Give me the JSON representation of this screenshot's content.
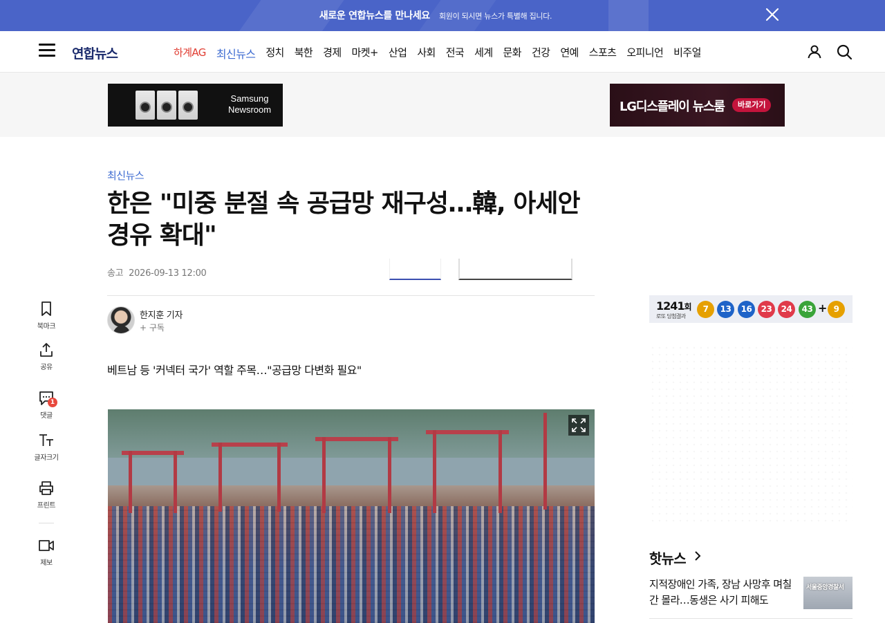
{
  "promo": {
    "main": "새로운 연합뉴스를 만나세요",
    "sub": "회원이 되시면 뉴스가 특별해 집니다.",
    "close_icon": "close-icon",
    "bg_color": "#4a64c8"
  },
  "header": {
    "logo": "연합뉴스",
    "menu_icon": "hamburger-menu-icon",
    "nav": [
      {
        "label": "하계AG",
        "state": "highlight"
      },
      {
        "label": "최신뉴스",
        "state": "active"
      },
      {
        "label": "정치"
      },
      {
        "label": "북한"
      },
      {
        "label": "경제"
      },
      {
        "label": "마켓+"
      },
      {
        "label": "산업"
      },
      {
        "label": "사회"
      },
      {
        "label": "전국"
      },
      {
        "label": "세계"
      },
      {
        "label": "문화"
      },
      {
        "label": "건강"
      },
      {
        "label": "연예"
      },
      {
        "label": "스포츠"
      },
      {
        "label": "오피니언"
      },
      {
        "label": "비주얼"
      }
    ],
    "user_icon": "user-icon",
    "search_icon": "search-icon",
    "accent_color": "#3d6bd1",
    "highlight_color": "#e03c31"
  },
  "ads": {
    "left_text_line1": "Samsung",
    "left_text_line2": "Newsroom",
    "right_text": "LG디스플레이 뉴스룸",
    "right_button": "바로가기"
  },
  "article": {
    "section": "최신뉴스",
    "headline": "한은 \"미중 분절 속 공급망 재구성…韓, 아세안 경유 확대\"",
    "date_label": "송고",
    "date": "2026-09-13 12:00",
    "reporter": "한지훈 기자",
    "subscribe": "+ 구독",
    "subtitle": "베트남 등 '커넥터 국가' 역할 주목…\"공급망 다변화 필요\"",
    "photo_expand_icon": "expand-icon"
  },
  "toolbar": {
    "bookmark": "북마크",
    "share": "공유",
    "comments": "댓글",
    "comment_count": "1",
    "font_size": "글자크기",
    "print": "프린트",
    "report": "제보"
  },
  "lotto": {
    "round_number": "1241",
    "round_suffix": "회",
    "sub": "로또 당첨결과",
    "balls": [
      {
        "n": "7",
        "color": "#e6a000"
      },
      {
        "n": "13",
        "color": "#1e63c8"
      },
      {
        "n": "16",
        "color": "#1e63c8"
      },
      {
        "n": "23",
        "color": "#e03a4a"
      },
      {
        "n": "24",
        "color": "#e03a4a"
      },
      {
        "n": "43",
        "color": "#3aa43a"
      }
    ],
    "plus": "+",
    "bonus": {
      "n": "9",
      "color": "#e6a000"
    }
  },
  "hot_news": {
    "title": "핫뉴스",
    "item_text": "지적장애인 가족, 장남 사망후 며칠간 몰라…동생은 사기 피해도",
    "thumb_text": "서울중앙경찰서"
  }
}
